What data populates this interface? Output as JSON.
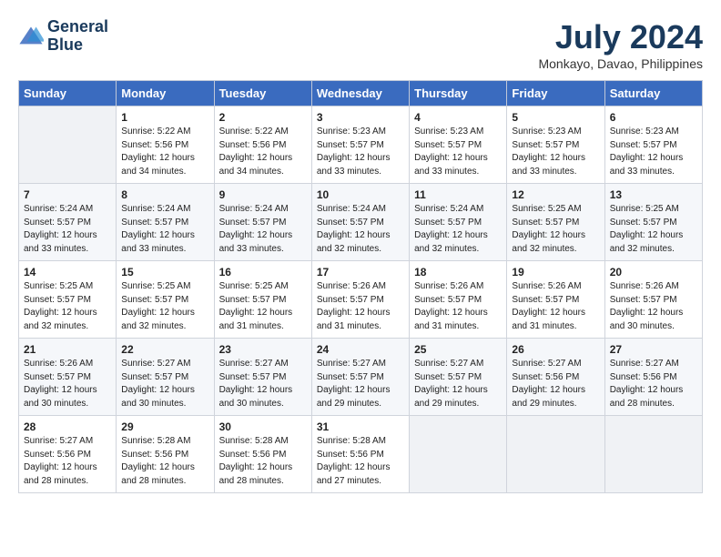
{
  "header": {
    "logo_line1": "General",
    "logo_line2": "Blue",
    "month_year": "July 2024",
    "location": "Monkayo, Davao, Philippines"
  },
  "days_of_week": [
    "Sunday",
    "Monday",
    "Tuesday",
    "Wednesday",
    "Thursday",
    "Friday",
    "Saturday"
  ],
  "weeks": [
    [
      {
        "day": "",
        "empty": true
      },
      {
        "day": "1",
        "sunrise": "5:22 AM",
        "sunset": "5:56 PM",
        "daylight": "12 hours and 34 minutes."
      },
      {
        "day": "2",
        "sunrise": "5:22 AM",
        "sunset": "5:56 PM",
        "daylight": "12 hours and 34 minutes."
      },
      {
        "day": "3",
        "sunrise": "5:23 AM",
        "sunset": "5:57 PM",
        "daylight": "12 hours and 33 minutes."
      },
      {
        "day": "4",
        "sunrise": "5:23 AM",
        "sunset": "5:57 PM",
        "daylight": "12 hours and 33 minutes."
      },
      {
        "day": "5",
        "sunrise": "5:23 AM",
        "sunset": "5:57 PM",
        "daylight": "12 hours and 33 minutes."
      },
      {
        "day": "6",
        "sunrise": "5:23 AM",
        "sunset": "5:57 PM",
        "daylight": "12 hours and 33 minutes."
      }
    ],
    [
      {
        "day": "7",
        "sunrise": "5:24 AM",
        "sunset": "5:57 PM",
        "daylight": "12 hours and 33 minutes."
      },
      {
        "day": "8",
        "sunrise": "5:24 AM",
        "sunset": "5:57 PM",
        "daylight": "12 hours and 33 minutes."
      },
      {
        "day": "9",
        "sunrise": "5:24 AM",
        "sunset": "5:57 PM",
        "daylight": "12 hours and 33 minutes."
      },
      {
        "day": "10",
        "sunrise": "5:24 AM",
        "sunset": "5:57 PM",
        "daylight": "12 hours and 32 minutes."
      },
      {
        "day": "11",
        "sunrise": "5:24 AM",
        "sunset": "5:57 PM",
        "daylight": "12 hours and 32 minutes."
      },
      {
        "day": "12",
        "sunrise": "5:25 AM",
        "sunset": "5:57 PM",
        "daylight": "12 hours and 32 minutes."
      },
      {
        "day": "13",
        "sunrise": "5:25 AM",
        "sunset": "5:57 PM",
        "daylight": "12 hours and 32 minutes."
      }
    ],
    [
      {
        "day": "14",
        "sunrise": "5:25 AM",
        "sunset": "5:57 PM",
        "daylight": "12 hours and 32 minutes."
      },
      {
        "day": "15",
        "sunrise": "5:25 AM",
        "sunset": "5:57 PM",
        "daylight": "12 hours and 32 minutes."
      },
      {
        "day": "16",
        "sunrise": "5:25 AM",
        "sunset": "5:57 PM",
        "daylight": "12 hours and 31 minutes."
      },
      {
        "day": "17",
        "sunrise": "5:26 AM",
        "sunset": "5:57 PM",
        "daylight": "12 hours and 31 minutes."
      },
      {
        "day": "18",
        "sunrise": "5:26 AM",
        "sunset": "5:57 PM",
        "daylight": "12 hours and 31 minutes."
      },
      {
        "day": "19",
        "sunrise": "5:26 AM",
        "sunset": "5:57 PM",
        "daylight": "12 hours and 31 minutes."
      },
      {
        "day": "20",
        "sunrise": "5:26 AM",
        "sunset": "5:57 PM",
        "daylight": "12 hours and 30 minutes."
      }
    ],
    [
      {
        "day": "21",
        "sunrise": "5:26 AM",
        "sunset": "5:57 PM",
        "daylight": "12 hours and 30 minutes."
      },
      {
        "day": "22",
        "sunrise": "5:27 AM",
        "sunset": "5:57 PM",
        "daylight": "12 hours and 30 minutes."
      },
      {
        "day": "23",
        "sunrise": "5:27 AM",
        "sunset": "5:57 PM",
        "daylight": "12 hours and 30 minutes."
      },
      {
        "day": "24",
        "sunrise": "5:27 AM",
        "sunset": "5:57 PM",
        "daylight": "12 hours and 29 minutes."
      },
      {
        "day": "25",
        "sunrise": "5:27 AM",
        "sunset": "5:57 PM",
        "daylight": "12 hours and 29 minutes."
      },
      {
        "day": "26",
        "sunrise": "5:27 AM",
        "sunset": "5:56 PM",
        "daylight": "12 hours and 29 minutes."
      },
      {
        "day": "27",
        "sunrise": "5:27 AM",
        "sunset": "5:56 PM",
        "daylight": "12 hours and 28 minutes."
      }
    ],
    [
      {
        "day": "28",
        "sunrise": "5:27 AM",
        "sunset": "5:56 PM",
        "daylight": "12 hours and 28 minutes."
      },
      {
        "day": "29",
        "sunrise": "5:28 AM",
        "sunset": "5:56 PM",
        "daylight": "12 hours and 28 minutes."
      },
      {
        "day": "30",
        "sunrise": "5:28 AM",
        "sunset": "5:56 PM",
        "daylight": "12 hours and 28 minutes."
      },
      {
        "day": "31",
        "sunrise": "5:28 AM",
        "sunset": "5:56 PM",
        "daylight": "12 hours and 27 minutes."
      },
      {
        "day": "",
        "empty": true
      },
      {
        "day": "",
        "empty": true
      },
      {
        "day": "",
        "empty": true
      }
    ]
  ]
}
